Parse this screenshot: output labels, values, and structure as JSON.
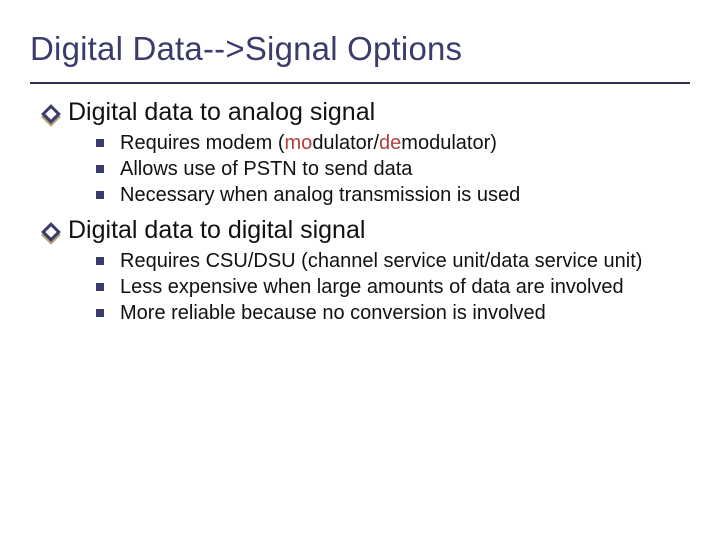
{
  "title": "Digital Data-->Signal Options",
  "sections": [
    {
      "heading": "Digital data to analog signal",
      "items": [
        {
          "pre": "Requires modem (",
          "a1": "mo",
          "mid1": "dulator/",
          "a2": "de",
          "mid2": "mo",
          "post": "dulator)"
        },
        {
          "text": "Allows use of PSTN to send data"
        },
        {
          "text": "Necessary when analog transmission is used"
        }
      ]
    },
    {
      "heading": "Digital data to digital signal",
      "items": [
        {
          "text": "Requires CSU/DSU (channel service unit/data service unit)"
        },
        {
          "text": "Less expensive when large amounts of data are involved"
        },
        {
          "text": "More reliable because no conversion is involved"
        }
      ]
    }
  ]
}
